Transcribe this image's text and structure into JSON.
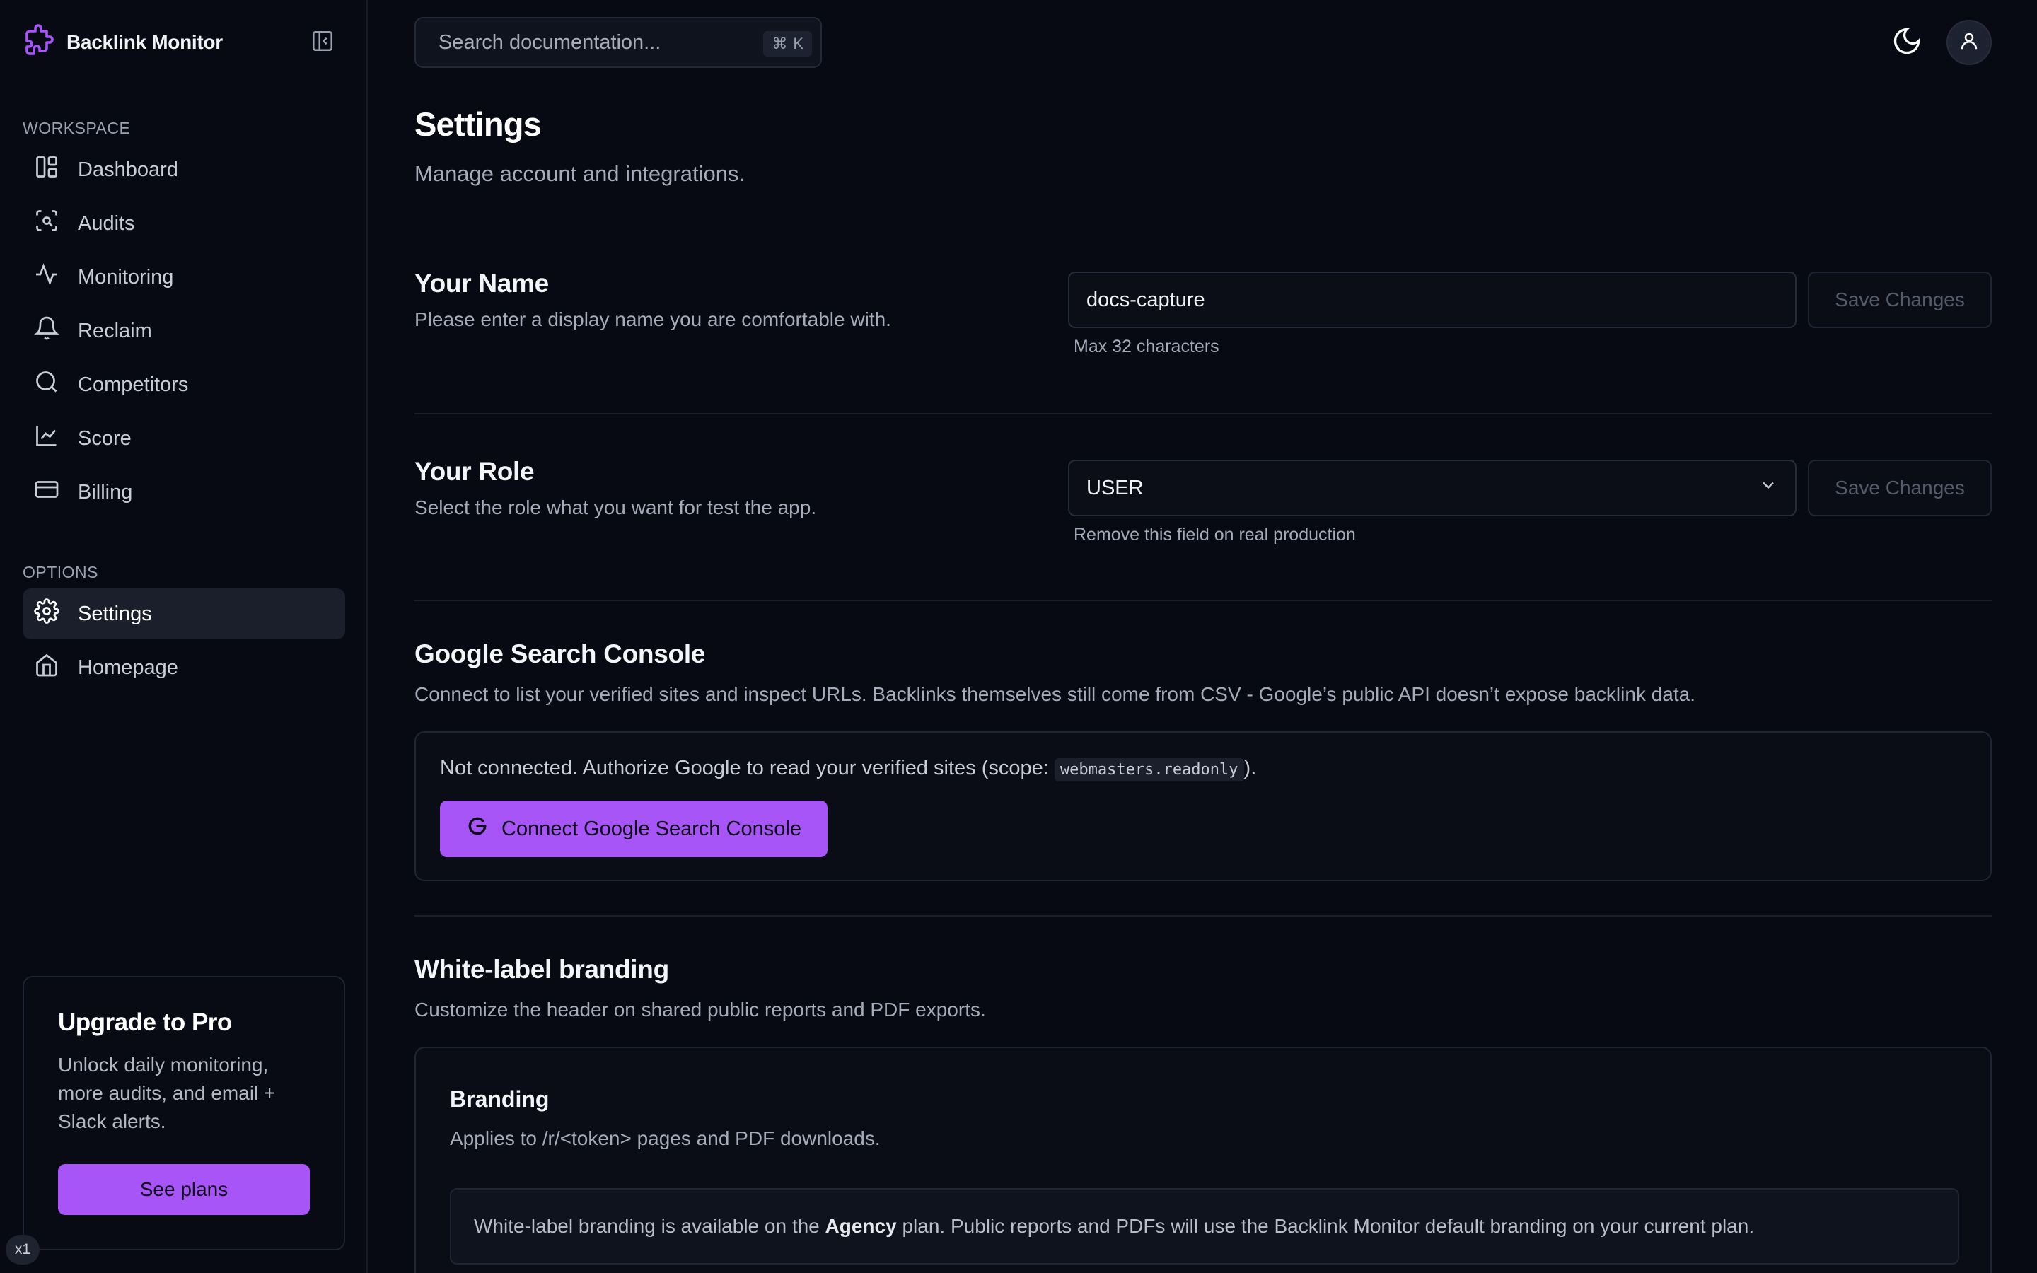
{
  "app": {
    "name": "Backlink Monitor"
  },
  "sidebar": {
    "workspace_label": "WORKSPACE",
    "workspace_items": [
      {
        "label": "Dashboard",
        "icon": "dashboard-icon"
      },
      {
        "label": "Audits",
        "icon": "scan-search-icon"
      },
      {
        "label": "Monitoring",
        "icon": "activity-icon"
      },
      {
        "label": "Reclaim",
        "icon": "bell-icon"
      },
      {
        "label": "Competitors",
        "icon": "search-icon"
      },
      {
        "label": "Score",
        "icon": "line-chart-icon"
      },
      {
        "label": "Billing",
        "icon": "credit-card-icon"
      }
    ],
    "options_label": "OPTIONS",
    "options_items": [
      {
        "label": "Settings",
        "icon": "gear-icon",
        "active": true
      },
      {
        "label": "Homepage",
        "icon": "home-icon"
      }
    ],
    "upgrade": {
      "title": "Upgrade to Pro",
      "text": "Unlock daily monitoring, more audits, and email + Slack alerts.",
      "button": "See plans"
    },
    "badge": "x1"
  },
  "header": {
    "search_placeholder": "Search documentation...",
    "search_shortcut_symbol": "⌘",
    "search_shortcut_key": "K"
  },
  "page": {
    "title": "Settings",
    "subtitle": "Manage account and integrations."
  },
  "name_section": {
    "title": "Your Name",
    "description": "Please enter a display name you are comfortable with.",
    "value": "docs-capture",
    "hint": "Max 32 characters",
    "save_label": "Save Changes"
  },
  "role_section": {
    "title": "Your Role",
    "description": "Select the role what you want for test the app.",
    "value": "USER",
    "hint": "Remove this field on real production",
    "save_label": "Save Changes"
  },
  "gsc_section": {
    "title": "Google Search Console",
    "description": "Connect to list your verified sites and inspect URLs. Backlinks themselves still come from CSV - Google’s public API doesn’t expose backlink data.",
    "status_prefix": "Not connected. Authorize Google to read your verified sites (scope: ",
    "scope": "webmasters.readonly",
    "status_suffix": ").",
    "button": "Connect Google Search Console"
  },
  "whitelabel_section": {
    "title": "White-label branding",
    "description": "Customize the header on shared public reports and PDF exports.",
    "card_title": "Branding",
    "card_description": "Applies to /r/<token> pages and PDF downloads.",
    "notice_prefix": "White-label branding is available on the ",
    "notice_plan": "Agency",
    "notice_suffix": " plan. Public reports and PDFs will use the Backlink Monitor default branding on your current plan."
  },
  "colors": {
    "accent": "#a855f7",
    "background": "#070a13",
    "surface": "#0a0d16",
    "border": "#1f2533"
  }
}
